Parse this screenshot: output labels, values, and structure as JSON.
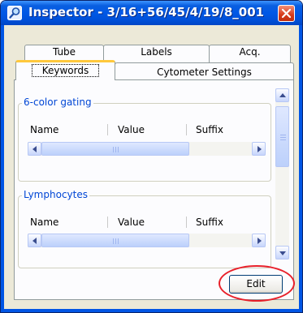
{
  "window": {
    "title": "Inspector - 3/16+56/45/4/19/8_001"
  },
  "tabs": {
    "back_row": [
      {
        "label": "Tube"
      },
      {
        "label": "Labels"
      },
      {
        "label": "Acq."
      }
    ],
    "front_row": [
      {
        "label": "Keywords",
        "active": true
      },
      {
        "label": "Cytometer Settings",
        "active": false
      }
    ]
  },
  "groups": [
    {
      "title": "6-color gating",
      "columns": [
        "Name",
        "Value",
        "Suffix"
      ]
    },
    {
      "title": "Lymphocytes",
      "columns": [
        "Name",
        "Value",
        "Suffix"
      ]
    }
  ],
  "actions": {
    "edit_label": "Edit"
  },
  "colors": {
    "title_bar": "#0058e6",
    "group_label": "#0046d5",
    "active_tab_accent": "#ffc83c",
    "highlight_ring": "#e8202a",
    "close_button": "#d63a1a"
  }
}
